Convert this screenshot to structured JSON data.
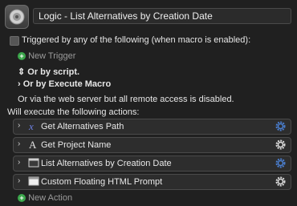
{
  "macro": {
    "title": "Logic - List Alternatives by Creation Date"
  },
  "triggers": {
    "triggered_label": "Triggered by any of the following (when macro is enabled):",
    "new_trigger": "New Trigger",
    "by_script": "Or by script.",
    "by_execute_macro": "Or by Execute Macro",
    "web_server_note": "Or via the web server but all remote access is disabled."
  },
  "actions": {
    "header": "Will execute the following actions:",
    "items": [
      {
        "label": "Get Alternatives Path",
        "icon": "variable-x-icon"
      },
      {
        "label": "Get Project Name",
        "icon": "text-a-icon"
      },
      {
        "label": "List Alternatives by Creation Date",
        "icon": "window-icon"
      },
      {
        "label": "Custom Floating HTML Prompt",
        "icon": "html-window-icon"
      }
    ],
    "new_action": "New Action"
  },
  "colors": {
    "background": "#202020",
    "accent_green": "#3aa64a",
    "gear_blue": "#4a7ecf"
  }
}
